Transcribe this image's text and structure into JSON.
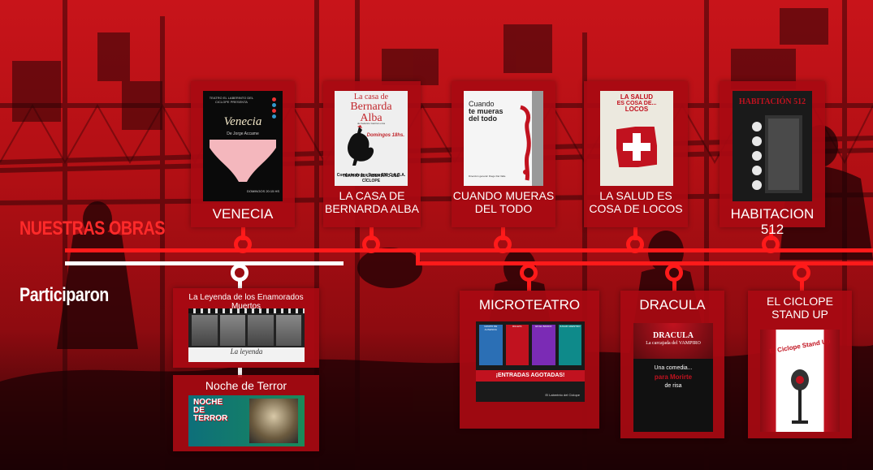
{
  "sections": {
    "obras_label": "NUESTRAS OBRAS",
    "participaron_label": "Participaron"
  },
  "colors": {
    "accent_red": "#ff1a1a",
    "card_bg": "#a80a12",
    "white_line": "#ffffff"
  },
  "obras": [
    {
      "title": "VENECIA",
      "poster": {
        "top_text": "TEATRO EL LABERINTO DEL CICLOPE PRESENTA",
        "name": "Venecia",
        "author": "De Jorge Accame",
        "footer": "DOMINGOS 20:15 HS"
      }
    },
    {
      "title_line1": "LA CASA DE",
      "title_line2": "BERNARDA ALBA",
      "poster": {
        "name_line1": "La casa de",
        "name_line2": "Bernarda",
        "name_line3": "Alba",
        "author": "de Federico García Lorca",
        "days": "Domingos 18hs.",
        "address": "Combate de los Pozos 550 C.A.B.A.",
        "theatre": "TEATRO EL LABERINTO DEL CÍCLOPE"
      }
    },
    {
      "title_line1": "CUANDO MUERAS",
      "title_line2": "DEL TODO",
      "poster": {
        "line1": "Cuando",
        "line2": "te mueras",
        "line3": "del todo",
        "footer": "Dirección general: Diego Del Valle"
      }
    },
    {
      "title_line1": "LA SALUD ES",
      "title_line2": "COSA DE LOCOS",
      "poster": {
        "line1": "LA SALUD",
        "line2": "ES COSA DE...",
        "line3": "LOCOS"
      }
    },
    {
      "title": "HABITACION 512",
      "poster": {
        "name": "HABITACIÓN 512"
      }
    }
  ],
  "participaron": [
    {
      "title": "La Leyenda de los Enamorados Muertos",
      "poster": {
        "caption": "La leyenda"
      }
    },
    {
      "title": "Noche de Terror",
      "poster": {
        "name": "NOCHE DE TERROR"
      }
    }
  ],
  "otros": [
    {
      "title": "MICROTEATRO",
      "poster": {
        "tiles": [
          "GRUPO DE AUSENCIA",
          "RULETA",
          "EN EL BANCO",
          "JUGAR ADENTRO"
        ],
        "banner": "¡ENTRADAS AGOTADAS!",
        "footer": "El Laberinto del Cíclope"
      }
    },
    {
      "title": "DRACULA",
      "poster": {
        "line1": "DRACULA",
        "line2": "La carcajada del VAMPIRO",
        "line3": "Una comedia...",
        "line4": "para Morirte",
        "line5": "de risa"
      }
    },
    {
      "title_line1": "EL CICLOPE",
      "title_line2": "STAND UP",
      "poster": {
        "line1": "El Ciclope Stand Up"
      }
    }
  ]
}
